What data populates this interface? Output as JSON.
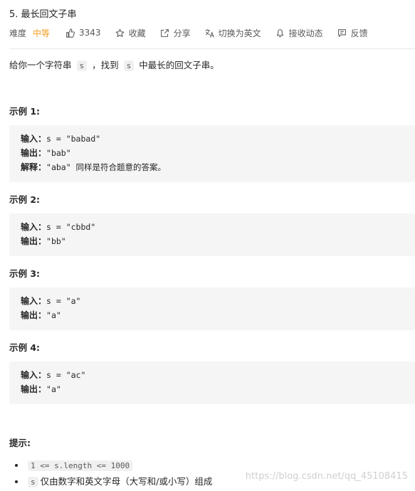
{
  "problem": {
    "title": "5. 最长回文子串",
    "difficulty_label": "难度",
    "difficulty": "中等",
    "actions": {
      "like_count": "3343",
      "favorite_label": "收藏",
      "share_label": "分享",
      "translate_label": "切换为英文",
      "notify_label": "接收动态",
      "feedback_label": "反馈"
    },
    "description": {
      "text1": "给你一个字符串",
      "code1": "s",
      "text2": "，找到",
      "code2": "s",
      "text3": "中最长的回文子串。"
    },
    "examples": [
      {
        "title": "示例 1:",
        "input_key": "输入：",
        "input_value": "s = \"babad\"",
        "output_key": "输出：",
        "output_value": "\"bab\"",
        "explain_key": "解释：",
        "explain_value": "\"aba\" 同样是符合题意的答案。"
      },
      {
        "title": "示例 2:",
        "input_key": "输入：",
        "input_value": "s = \"cbbd\"",
        "output_key": "输出：",
        "output_value": "\"bb\""
      },
      {
        "title": "示例 3:",
        "input_key": "输入：",
        "input_value": "s = \"a\"",
        "output_key": "输出：",
        "output_value": "\"a\""
      },
      {
        "title": "示例 4:",
        "input_key": "输入：",
        "input_value": "s = \"ac\"",
        "output_key": "输出：",
        "output_value": "\"a\""
      }
    ],
    "hints": {
      "title": "提示:",
      "item1_code": "1 <= s.length <= 1000",
      "item2_code": "s",
      "item2_text": "仅由数字和英文字母（大写和/或小写）组成"
    }
  },
  "watermark": "https://blog.csdn.net/qq_45108415",
  "colors": {
    "difficulty_medium": "#f0a020",
    "code_bg": "#f5f5f5",
    "divider": "#e8e8e8"
  },
  "icons": [
    "thumbs-up-icon",
    "star-icon",
    "share-icon",
    "translate-icon",
    "bell-icon",
    "feedback-icon"
  ]
}
